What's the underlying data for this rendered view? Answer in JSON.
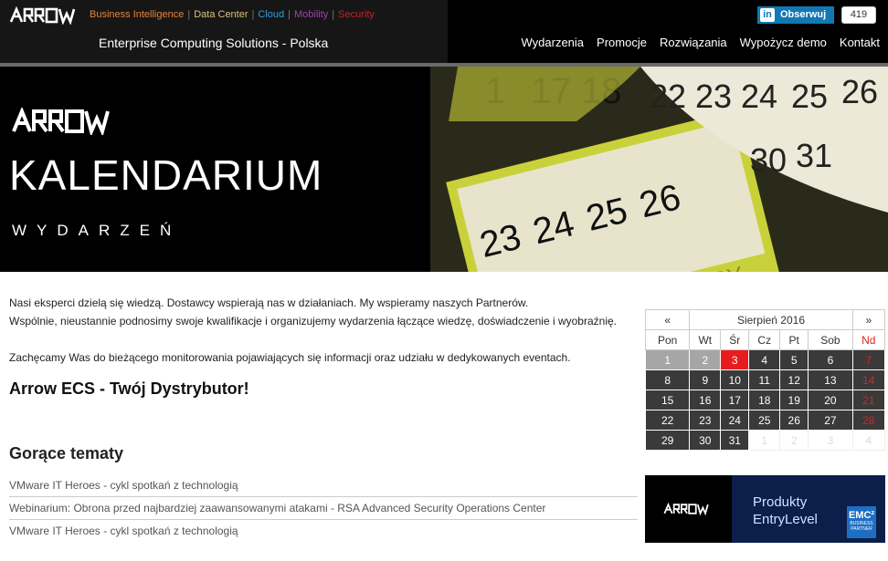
{
  "header": {
    "brand": "ARROW",
    "divisions": [
      {
        "label": "Business Intelligence",
        "color": "#e8823a"
      },
      {
        "label": "Data Center",
        "color": "#d9c37a"
      },
      {
        "label": "Cloud",
        "color": "#2e9ee0"
      },
      {
        "label": "Mobility",
        "color": "#a23fb0"
      },
      {
        "label": "Security",
        "color": "#c0242a"
      }
    ],
    "company": "Enterprise Computing Solutions - Polska",
    "follow_label": "Obserwuj",
    "follow_icon": "linkedin-icon",
    "follow_count": "419",
    "nav": [
      "Wydarzenia",
      "Promocje",
      "Rozwiązania",
      "Wypożycz demo",
      "Kontakt"
    ]
  },
  "banner": {
    "title": "KALENDARIUM",
    "subtitle": "WYDARZEŃ",
    "image_label": "calendar-pages-image"
  },
  "intro": {
    "line1": "Nasi eksperci dzielą się wiedzą. Dostawcy wspierają nas w działaniach. My wspieramy naszych Partnerów.",
    "line2": "Wspólnie, nieustannie podnosimy swoje kwalifikacje i organizujemy wydarzenia łączące wiedzę, doświadczenie i wyobraźnię.",
    "line3": "Zachęcamy Was do bieżącego monitorowania pojawiających się informacji oraz udziału w dedykowanych eventach."
  },
  "headline": "Arrow ECS - Twój Dystrybutor!",
  "hot": {
    "title": "Gorące tematy",
    "items": [
      "VMware IT Heroes - cykl spotkań z technologią",
      "Webinarium: Obrona przed najbardziej zaawansowanymi atakami - RSA Advanced Security Operations Center",
      "VMware IT Heroes - cykl spotkań z technologią"
    ]
  },
  "calendar": {
    "prev": "«",
    "next": "»",
    "month": "Sierpień 2016",
    "days": [
      "Pon",
      "Wt",
      "Śr",
      "Cz",
      "Pt",
      "Sob",
      "Nd"
    ],
    "weeks": [
      [
        "1",
        "2",
        "3",
        "4",
        "5",
        "6",
        "7"
      ],
      [
        "8",
        "9",
        "10",
        "11",
        "12",
        "13",
        "14"
      ],
      [
        "15",
        "16",
        "17",
        "18",
        "19",
        "20",
        "21"
      ],
      [
        "22",
        "23",
        "24",
        "25",
        "26",
        "27",
        "28"
      ],
      [
        "29",
        "30",
        "31",
        "1",
        "2",
        "3",
        "4"
      ]
    ],
    "today": "3"
  },
  "ad": {
    "brand": "ARROW",
    "line1": "Produkty",
    "line2": "EntryLevel",
    "partner_brand": "EMC²",
    "partner_line1": "BUSINESS",
    "partner_line2": "PARTNER"
  }
}
